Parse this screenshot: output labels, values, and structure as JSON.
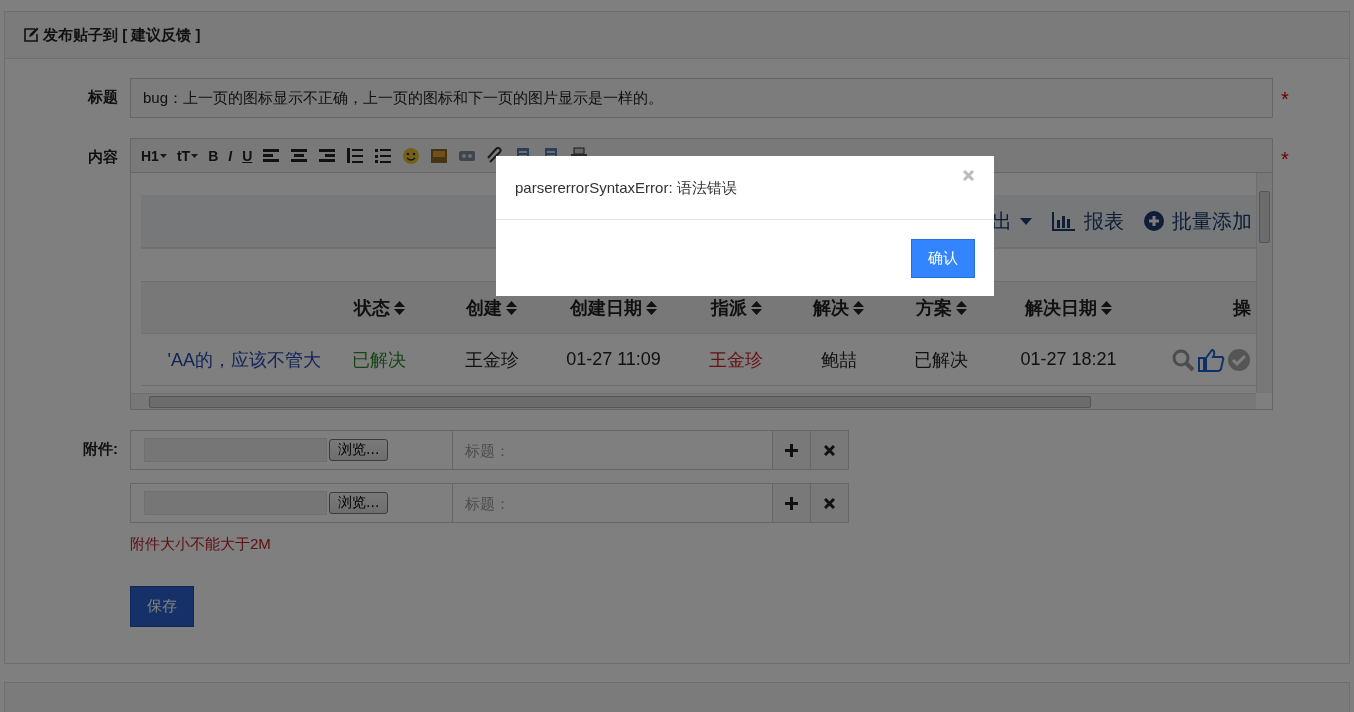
{
  "panel": {
    "title": "发布贴子到 [ 建议反馈 ]"
  },
  "title_row": {
    "label": "标题",
    "value": "bug：上一页的图标显示不正确，上一页的图标和下一页的图片显示是一样的。",
    "required_mark": "*"
  },
  "content_row": {
    "label": "内容",
    "required_mark": "*"
  },
  "editor_toolbar": [
    {
      "kind": "text",
      "label": "H1",
      "menu": true
    },
    {
      "kind": "text",
      "label": "tT",
      "menu": true
    },
    {
      "kind": "text",
      "label": "B",
      "menu": false
    },
    {
      "kind": "text",
      "label": "I",
      "menu": false
    },
    {
      "kind": "text",
      "label": "U",
      "menu": false
    },
    {
      "kind": "align-left"
    },
    {
      "kind": "align-center"
    },
    {
      "kind": "align-right"
    },
    {
      "kind": "ordered-list"
    },
    {
      "kind": "bullet-list"
    },
    {
      "kind": "smiley"
    },
    {
      "kind": "image"
    },
    {
      "kind": "media"
    },
    {
      "kind": "attach"
    },
    {
      "kind": "doc"
    },
    {
      "kind": "doc"
    },
    {
      "kind": "print"
    }
  ],
  "editor_content": {
    "actions": [
      {
        "kind": "menu",
        "label": "出"
      },
      {
        "kind": "report",
        "label": "报表"
      },
      {
        "kind": "add",
        "label": "批量添加"
      }
    ],
    "columns": [
      {
        "sortable": false
      },
      {
        "label": "状态",
        "sortable": true
      },
      {
        "label": "创建",
        "sortable": true
      },
      {
        "label": "创建日期",
        "sortable": true
      },
      {
        "label": "指派",
        "sortable": true
      },
      {
        "label": "解决",
        "sortable": true
      },
      {
        "label": "方案",
        "sortable": true
      },
      {
        "label": "解决日期",
        "sortable": true
      },
      {
        "label": "操",
        "sortable": false
      }
    ],
    "rows": [
      {
        "cells": [
          {
            "text": "'AA的，应该不管大",
            "kind": "link"
          },
          {
            "text": "已解决",
            "kind": "success"
          },
          {
            "text": "王金珍",
            "kind": "plain"
          },
          {
            "text": "01-27 11:09",
            "kind": "plain"
          },
          {
            "text": "王金珍",
            "kind": "alert"
          },
          {
            "text": "鲍喆",
            "kind": "plain"
          },
          {
            "text": "已解决",
            "kind": "plain"
          },
          {
            "text": "01-27 18:21",
            "kind": "plain"
          }
        ]
      }
    ]
  },
  "attachments": {
    "label": "附件:",
    "rows": [
      {
        "browse": "浏览...",
        "title_placeholder": "标题："
      },
      {
        "browse": "浏览...",
        "title_placeholder": "标题："
      }
    ],
    "note": "附件大小不能大于2M"
  },
  "save": "保存",
  "modal": {
    "message": "parsererrorSyntaxError: 语法错误",
    "confirm": "确认"
  }
}
